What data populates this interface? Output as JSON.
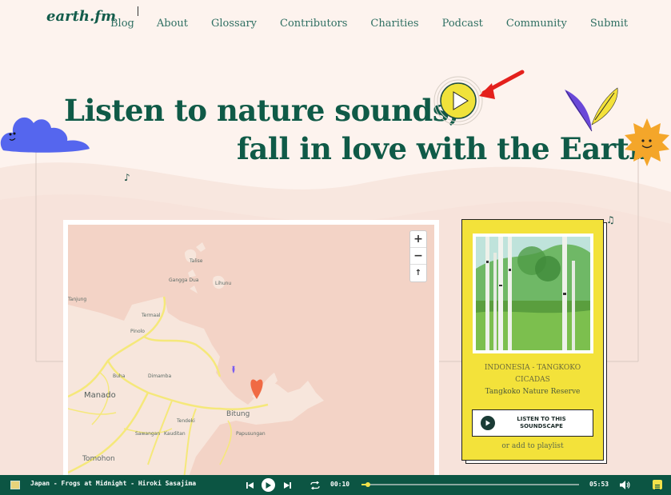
{
  "logo": "earth.fm",
  "nav": {
    "items": [
      {
        "label": "Blog"
      },
      {
        "label": "About"
      },
      {
        "label": "Glossary"
      },
      {
        "label": "Contributors"
      },
      {
        "label": "Charities"
      },
      {
        "label": "Podcast"
      },
      {
        "label": "Community"
      },
      {
        "label": "Submit"
      }
    ]
  },
  "hero": {
    "line1": "Listen to nature sounds,",
    "line2": "fall in love with the Earth"
  },
  "map": {
    "zoom_in": "+",
    "zoom_out": "−",
    "compass": "↑",
    "labels": {
      "talise": "Talise",
      "gangga": "Gangga Dua",
      "lihunu": "Lihunu",
      "tanjung": "Tanjung",
      "termaal": "Termaal",
      "pinolo": "Pinolo",
      "manado": "Manado",
      "buha": "Buha",
      "dimamba": "Dimamba",
      "tendeki": "Tendeki",
      "bitung": "Bitung",
      "sawangan": "Sawangan",
      "kauditan": "Kauditan",
      "papusungan": "Papusungan",
      "tomohon": "Tomohon"
    }
  },
  "card": {
    "title": "INDONESIA - TANGKOKO CICADAS",
    "subtitle": "Tangkoko Nature Reserve",
    "listen_label": "LISTEN TO THIS SOUNDSCAPE",
    "playlist_label": "or add to playlist"
  },
  "player": {
    "track": "Japan - Frogs at Midnight - Hiroki Sasajima",
    "current_time": "00:10",
    "duration": "05:53",
    "progress": 0.03
  },
  "colors": {
    "brand_green": "#0f5a47",
    "player_bg": "#0c5543",
    "card_yellow": "#f3e23a",
    "accent_yellow": "#f2e24a",
    "map_bg": "#f3d3c6",
    "road": "#f5e87a",
    "heart_red": "#f06a44",
    "heart_purple": "#7a5cf0"
  }
}
